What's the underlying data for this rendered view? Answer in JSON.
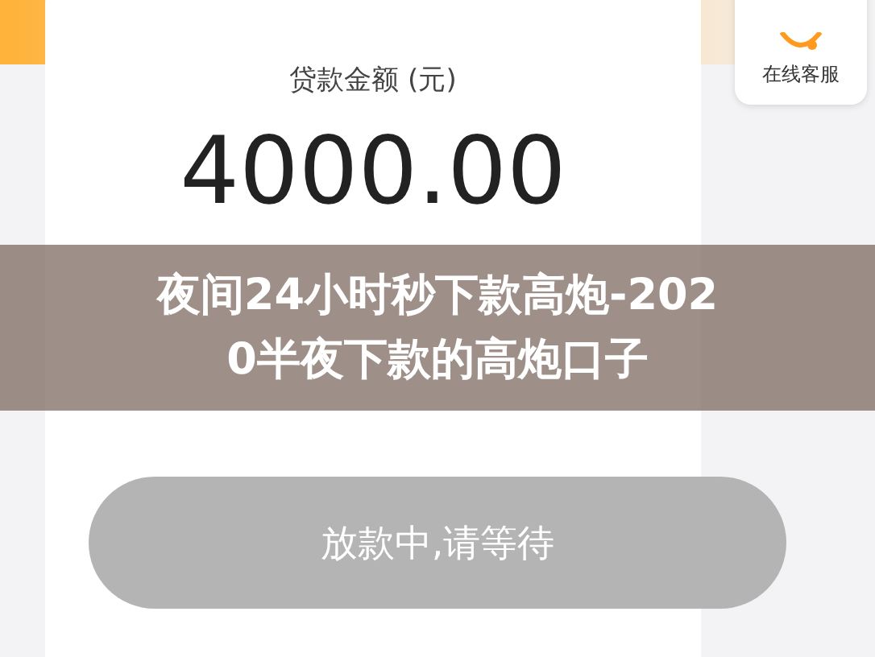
{
  "service_button": {
    "label": "在线客服"
  },
  "amount": {
    "label": "贷款金额 (元)",
    "value": "4000.00"
  },
  "status_button": {
    "label": "放款中,请等待",
    "disabled": true
  },
  "caption": {
    "lines": [
      "夜间24小时秒下款高炮-202",
      "0半夜下款的高炮口子"
    ]
  }
}
